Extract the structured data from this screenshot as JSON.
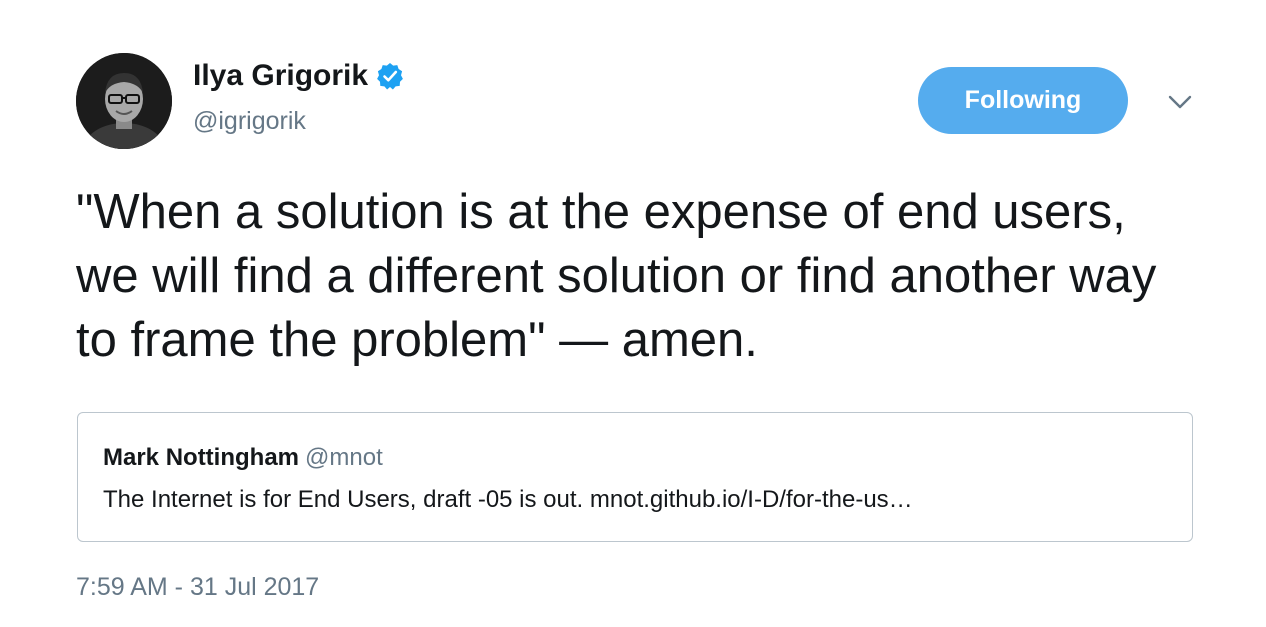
{
  "author": {
    "display_name": "Ilya Grigorik",
    "handle": "@igrigorik",
    "verified": true,
    "avatar_icon": "user-avatar"
  },
  "follow_button": {
    "label": "Following",
    "color": "#55acee"
  },
  "menu_icon": "chevron-down-icon",
  "tweet": {
    "text": "\"When a solution is at the expense of end users, we will find a different solution or find another way to frame the problem\" — amen."
  },
  "quoted_tweet": {
    "author_name": "Mark Nottingham",
    "author_handle": "@mnot",
    "text": "The Internet is for End Users, draft -05 is out. mnot.github.io/I-D/for-the-us…"
  },
  "timestamp": "7:59 AM - 31 Jul 2017",
  "colors": {
    "accent": "#55acee",
    "verified_badge": "#1da1f2",
    "secondary_text": "#657786",
    "primary_text": "#14171a",
    "card_border": "#bcc6ce"
  }
}
